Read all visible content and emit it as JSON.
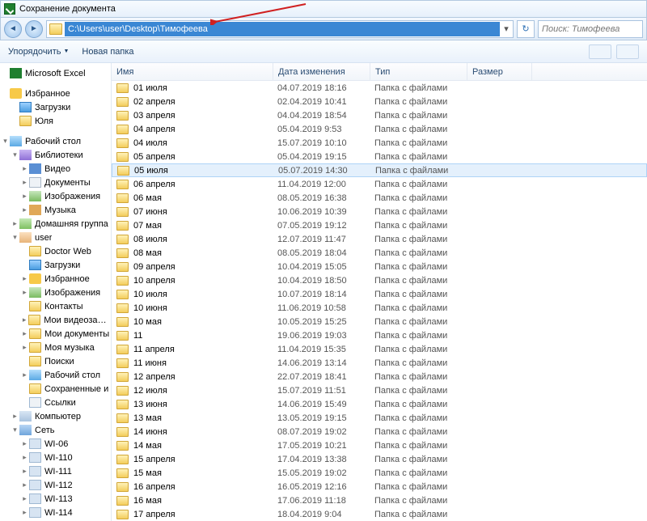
{
  "window": {
    "title": "Сохранение документа"
  },
  "address": {
    "path": "C:\\Users\\user\\Desktop\\Тимофеева",
    "search_placeholder": "Поиск: Тимофеева"
  },
  "toolbar": {
    "organize": "Упорядочить",
    "newfolder": "Новая папка"
  },
  "columns": {
    "name": "Имя",
    "date": "Дата изменения",
    "type": "Тип",
    "size": "Размер"
  },
  "sidebar": [
    {
      "ind": 0,
      "icon": "i-excel",
      "label": "Microsoft Excel",
      "tw": ""
    },
    {
      "ind": 0,
      "icon": "",
      "label": "",
      "tw": "",
      "spacer": true
    },
    {
      "ind": 0,
      "icon": "i-star",
      "label": "Избранное",
      "tw": ""
    },
    {
      "ind": 1,
      "icon": "i-blue",
      "label": "Загрузки",
      "tw": ""
    },
    {
      "ind": 1,
      "icon": "fico",
      "label": "Юля",
      "tw": ""
    },
    {
      "ind": 0,
      "icon": "",
      "label": "",
      "tw": "",
      "spacer": true
    },
    {
      "ind": 0,
      "icon": "i-desk",
      "label": "Рабочий стол",
      "tw": "▾"
    },
    {
      "ind": 1,
      "icon": "i-lib",
      "label": "Библиотеки",
      "tw": "▾"
    },
    {
      "ind": 2,
      "icon": "i-vid",
      "label": "Видео",
      "tw": "▸"
    },
    {
      "ind": 2,
      "icon": "i-doc",
      "label": "Документы",
      "tw": "▸"
    },
    {
      "ind": 2,
      "icon": "i-img",
      "label": "Изображения",
      "tw": "▸"
    },
    {
      "ind": 2,
      "icon": "i-mus",
      "label": "Музыка",
      "tw": "▸"
    },
    {
      "ind": 1,
      "icon": "i-home",
      "label": "Домашняя группа",
      "tw": "▸"
    },
    {
      "ind": 1,
      "icon": "i-user",
      "label": "user",
      "tw": "▾"
    },
    {
      "ind": 2,
      "icon": "fico",
      "label": "Doctor Web",
      "tw": ""
    },
    {
      "ind": 2,
      "icon": "i-blue",
      "label": "Загрузки",
      "tw": ""
    },
    {
      "ind": 2,
      "icon": "i-star",
      "label": "Избранное",
      "tw": "▸"
    },
    {
      "ind": 2,
      "icon": "i-img",
      "label": "Изображения",
      "tw": "▸"
    },
    {
      "ind": 2,
      "icon": "fico",
      "label": "Контакты",
      "tw": ""
    },
    {
      "ind": 2,
      "icon": "fico",
      "label": "Мои видеозаписи",
      "tw": "▸"
    },
    {
      "ind": 2,
      "icon": "fico",
      "label": "Мои документы",
      "tw": "▸"
    },
    {
      "ind": 2,
      "icon": "fico",
      "label": "Моя музыка",
      "tw": "▸"
    },
    {
      "ind": 2,
      "icon": "fico",
      "label": "Поиски",
      "tw": ""
    },
    {
      "ind": 2,
      "icon": "i-desk",
      "label": "Рабочий стол",
      "tw": "▸"
    },
    {
      "ind": 2,
      "icon": "fico",
      "label": "Сохраненные и",
      "tw": ""
    },
    {
      "ind": 2,
      "icon": "i-link",
      "label": "Ссылки",
      "tw": ""
    },
    {
      "ind": 1,
      "icon": "i-comp",
      "label": "Компьютер",
      "tw": "▸"
    },
    {
      "ind": 1,
      "icon": "i-net",
      "label": "Сеть",
      "tw": "▾"
    },
    {
      "ind": 2,
      "icon": "i-pc",
      "label": "WI-06",
      "tw": "▸"
    },
    {
      "ind": 2,
      "icon": "i-pc",
      "label": "WI-110",
      "tw": "▸"
    },
    {
      "ind": 2,
      "icon": "i-pc",
      "label": "WI-111",
      "tw": "▸"
    },
    {
      "ind": 2,
      "icon": "i-pc",
      "label": "WI-112",
      "tw": "▸"
    },
    {
      "ind": 2,
      "icon": "i-pc",
      "label": "WI-113",
      "tw": "▸"
    },
    {
      "ind": 2,
      "icon": "i-pc",
      "label": "WI-114",
      "tw": "▸"
    }
  ],
  "files": [
    {
      "name": "01 июля",
      "date": "04.07.2019 18:16",
      "type": "Папка с файлами"
    },
    {
      "name": "02 апреля",
      "date": "02.04.2019 10:41",
      "type": "Папка с файлами"
    },
    {
      "name": "03 апреля",
      "date": "04.04.2019 18:54",
      "type": "Папка с файлами"
    },
    {
      "name": "04 апреля",
      "date": "05.04.2019 9:53",
      "type": "Папка с файлами"
    },
    {
      "name": "04 июля",
      "date": "15.07.2019 10:10",
      "type": "Папка с файлами"
    },
    {
      "name": "05 апреля",
      "date": "05.04.2019 19:15",
      "type": "Папка с файлами"
    },
    {
      "name": "05 июля",
      "date": "05.07.2019 14:30",
      "type": "Папка с файлами",
      "sel": true
    },
    {
      "name": "06 апреля",
      "date": "11.04.2019 12:00",
      "type": "Папка с файлами"
    },
    {
      "name": "06 мая",
      "date": "08.05.2019 16:38",
      "type": "Папка с файлами"
    },
    {
      "name": "07 июня",
      "date": "10.06.2019 10:39",
      "type": "Папка с файлами"
    },
    {
      "name": "07 мая",
      "date": "07.05.2019 19:12",
      "type": "Папка с файлами"
    },
    {
      "name": "08 июля",
      "date": "12.07.2019 11:47",
      "type": "Папка с файлами"
    },
    {
      "name": "08 мая",
      "date": "08.05.2019 18:04",
      "type": "Папка с файлами"
    },
    {
      "name": "09 апреля",
      "date": "10.04.2019 15:05",
      "type": "Папка с файлами"
    },
    {
      "name": "10 апреля",
      "date": "10.04.2019 18:50",
      "type": "Папка с файлами"
    },
    {
      "name": "10 июля",
      "date": "10.07.2019 18:14",
      "type": "Папка с файлами"
    },
    {
      "name": "10 июня",
      "date": "11.06.2019 10:58",
      "type": "Папка с файлами"
    },
    {
      "name": "10 мая",
      "date": "10.05.2019 15:25",
      "type": "Папка с файлами"
    },
    {
      "name": "11",
      "date": "19.06.2019 19:03",
      "type": "Папка с файлами"
    },
    {
      "name": "11 апреля",
      "date": "11.04.2019 15:35",
      "type": "Папка с файлами"
    },
    {
      "name": "11 июня",
      "date": "14.06.2019 13:14",
      "type": "Папка с файлами"
    },
    {
      "name": "12 апреля",
      "date": "22.07.2019 18:41",
      "type": "Папка с файлами"
    },
    {
      "name": "12 июля",
      "date": "15.07.2019 11:51",
      "type": "Папка с файлами"
    },
    {
      "name": "13 июня",
      "date": "14.06.2019 15:49",
      "type": "Папка с файлами"
    },
    {
      "name": "13 мая",
      "date": "13.05.2019 19:15",
      "type": "Папка с файлами"
    },
    {
      "name": "14 июня",
      "date": "08.07.2019 19:02",
      "type": "Папка с файлами"
    },
    {
      "name": "14 мая",
      "date": "17.05.2019 10:21",
      "type": "Папка с файлами"
    },
    {
      "name": "15 апреля",
      "date": "17.04.2019 13:38",
      "type": "Папка с файлами"
    },
    {
      "name": "15 мая",
      "date": "15.05.2019 19:02",
      "type": "Папка с файлами"
    },
    {
      "name": "16 апреля",
      "date": "16.05.2019 12:16",
      "type": "Папка с файлами"
    },
    {
      "name": "16 мая",
      "date": "17.06.2019 11:18",
      "type": "Папка с файлами"
    },
    {
      "name": "17 апреля",
      "date": "18.04.2019 9:04",
      "type": "Папка с файлами"
    }
  ]
}
